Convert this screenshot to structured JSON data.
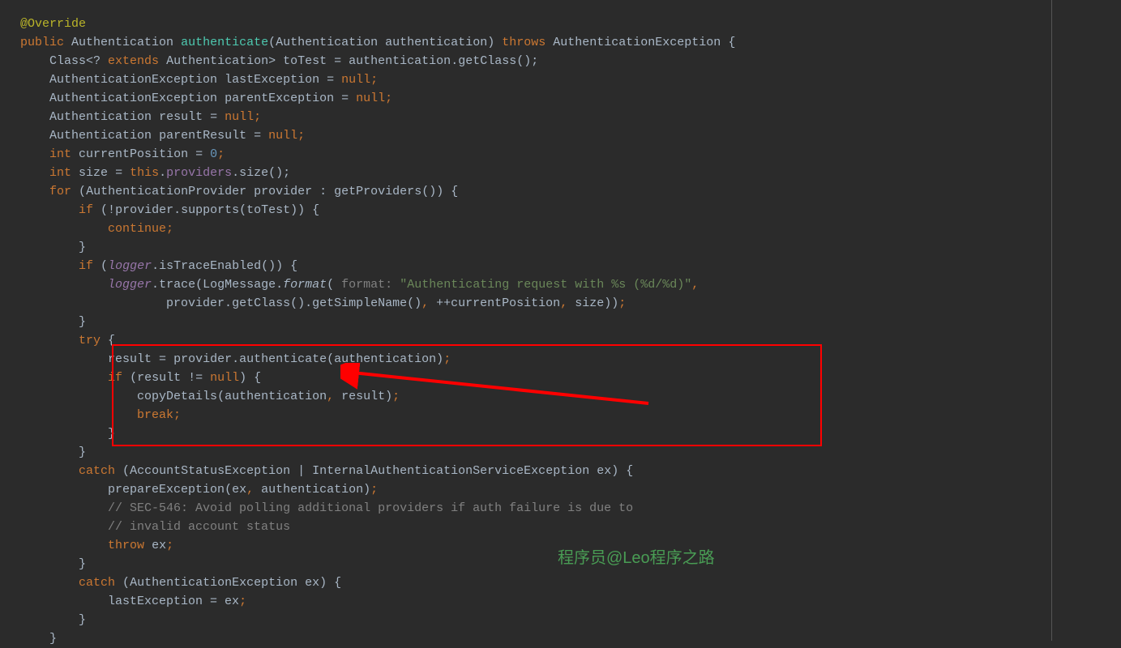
{
  "code": {
    "annotation_override": "@Override",
    "kw_public": "public",
    "type_authentication": "Authentication",
    "method_authenticate": "authenticate",
    "param_authentication": "authentication",
    "kw_throws": "throws",
    "type_auth_exception": "AuthenticationException",
    "type_class": "Class",
    "wildcard_extends": "<? ",
    "kw_extends": "extends",
    "var_totest": "toTest",
    "equals": " = ",
    "method_getclass": "getClass",
    "var_lastexception": "lastException",
    "kw_null": "null",
    "var_parentexception": "parentException",
    "var_result": "result",
    "var_parentresult": "parentResult",
    "kw_int": "int",
    "var_currentposition": "currentPosition",
    "num_zero": "0",
    "var_size": "size",
    "kw_this": "this",
    "field_providers": "providers",
    "method_size": "size",
    "kw_for": "for",
    "type_authprovider": "AuthenticationProvider",
    "var_provider": "provider",
    "method_getproviders": "getProviders",
    "kw_if": "if",
    "method_supports": "supports",
    "kw_continue": "continue",
    "field_logger": "logger",
    "method_istraceenabled": "isTraceEnabled",
    "method_trace": "trace",
    "type_logmessage": "LogMessage",
    "method_format": "format",
    "param_hint_format": "format:",
    "str_authenticating": "\"Authenticating request with %s (%d/%d)\"",
    "method_getsimplename": "getSimpleName",
    "inc_position": "++currentPosition",
    "kw_try": "try",
    "kw_neq": "!=",
    "method_copydetails": "copyDetails",
    "kw_break": "break",
    "kw_catch": "catch",
    "type_accountstatus": "AccountStatusException",
    "type_internalauth": "InternalAuthenticationServiceException",
    "var_ex": "ex",
    "method_prepareexception": "prepareException",
    "comment_sec546": "// SEC-546: Avoid polling additional providers if auth failure is due to",
    "comment_invalid": "// invalid account status",
    "kw_throw": "throw",
    "assign_lastex": "lastException = ex"
  },
  "watermark": "程序员@Leo程序之路",
  "colors": {
    "background": "#2b2b2b",
    "highlight_border": "#ff0000",
    "arrow": "#ff0000"
  }
}
